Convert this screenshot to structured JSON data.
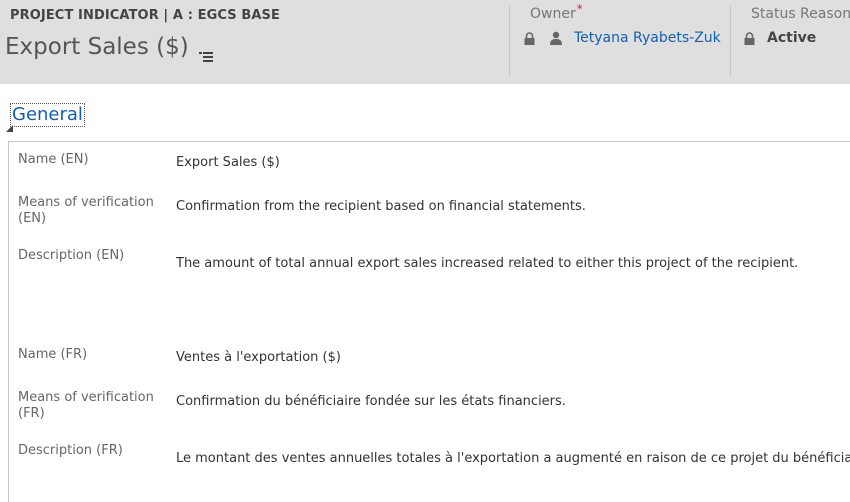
{
  "header": {
    "entity_type": "PROJECT INDICATOR | A : EGCS BASE",
    "record_title": "Export Sales ($)",
    "owner": {
      "label": "Owner",
      "required_marker": "*",
      "value": "Tetyana Ryabets-Zuk"
    },
    "status_reason": {
      "label": "Status Reason",
      "value": "Active"
    }
  },
  "section": {
    "title": "General",
    "fields": [
      {
        "label": "Name (EN)",
        "value": "Export Sales ($)"
      },
      {
        "label": "Means of verification (EN)",
        "value": "Confirmation from the recipient based on financial statements."
      },
      {
        "label": "Description (EN)",
        "value": "The amount of total annual export sales increased related to either this project of the recipient."
      },
      {
        "label": "Name (FR)",
        "value": "Ventes à l'exportation ($)"
      },
      {
        "label": "Means of verification (FR)",
        "value": "Confirmation du bénéficiaire fondée sur les états financiers."
      },
      {
        "label": "Description (FR)",
        "value": "Le montant des ventes annuelles totales à l'exportation a augmenté en raison de ce projet du bénéficiaire."
      }
    ]
  },
  "icons": {
    "menu": "hamburger-menu-icon",
    "lock": "lock-icon",
    "user": "user-icon",
    "collapse": "collapse-arrow-icon"
  },
  "colors": {
    "header_bg": "#dfdfdf",
    "link": "#1160b7",
    "required": "#d62d20"
  }
}
